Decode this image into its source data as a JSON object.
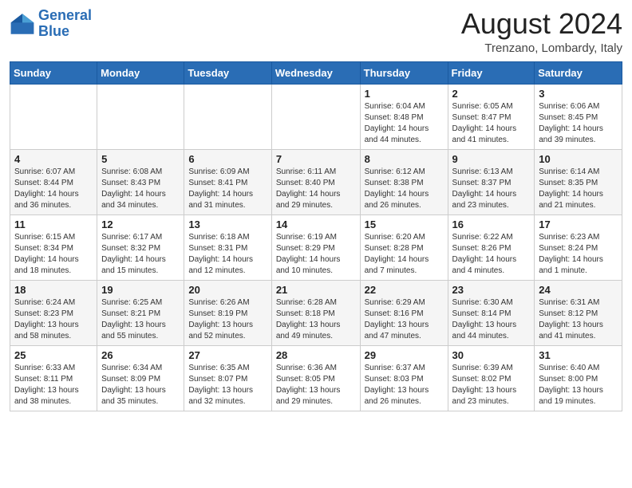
{
  "header": {
    "logo_line1": "General",
    "logo_line2": "Blue",
    "month_year": "August 2024",
    "location": "Trenzano, Lombardy, Italy"
  },
  "weekdays": [
    "Sunday",
    "Monday",
    "Tuesday",
    "Wednesday",
    "Thursday",
    "Friday",
    "Saturday"
  ],
  "weeks": [
    [
      {
        "day": "",
        "info": ""
      },
      {
        "day": "",
        "info": ""
      },
      {
        "day": "",
        "info": ""
      },
      {
        "day": "",
        "info": ""
      },
      {
        "day": "1",
        "info": "Sunrise: 6:04 AM\nSunset: 8:48 PM\nDaylight: 14 hours and 44 minutes."
      },
      {
        "day": "2",
        "info": "Sunrise: 6:05 AM\nSunset: 8:47 PM\nDaylight: 14 hours and 41 minutes."
      },
      {
        "day": "3",
        "info": "Sunrise: 6:06 AM\nSunset: 8:45 PM\nDaylight: 14 hours and 39 minutes."
      }
    ],
    [
      {
        "day": "4",
        "info": "Sunrise: 6:07 AM\nSunset: 8:44 PM\nDaylight: 14 hours and 36 minutes."
      },
      {
        "day": "5",
        "info": "Sunrise: 6:08 AM\nSunset: 8:43 PM\nDaylight: 14 hours and 34 minutes."
      },
      {
        "day": "6",
        "info": "Sunrise: 6:09 AM\nSunset: 8:41 PM\nDaylight: 14 hours and 31 minutes."
      },
      {
        "day": "7",
        "info": "Sunrise: 6:11 AM\nSunset: 8:40 PM\nDaylight: 14 hours and 29 minutes."
      },
      {
        "day": "8",
        "info": "Sunrise: 6:12 AM\nSunset: 8:38 PM\nDaylight: 14 hours and 26 minutes."
      },
      {
        "day": "9",
        "info": "Sunrise: 6:13 AM\nSunset: 8:37 PM\nDaylight: 14 hours and 23 minutes."
      },
      {
        "day": "10",
        "info": "Sunrise: 6:14 AM\nSunset: 8:35 PM\nDaylight: 14 hours and 21 minutes."
      }
    ],
    [
      {
        "day": "11",
        "info": "Sunrise: 6:15 AM\nSunset: 8:34 PM\nDaylight: 14 hours and 18 minutes."
      },
      {
        "day": "12",
        "info": "Sunrise: 6:17 AM\nSunset: 8:32 PM\nDaylight: 14 hours and 15 minutes."
      },
      {
        "day": "13",
        "info": "Sunrise: 6:18 AM\nSunset: 8:31 PM\nDaylight: 14 hours and 12 minutes."
      },
      {
        "day": "14",
        "info": "Sunrise: 6:19 AM\nSunset: 8:29 PM\nDaylight: 14 hours and 10 minutes."
      },
      {
        "day": "15",
        "info": "Sunrise: 6:20 AM\nSunset: 8:28 PM\nDaylight: 14 hours and 7 minutes."
      },
      {
        "day": "16",
        "info": "Sunrise: 6:22 AM\nSunset: 8:26 PM\nDaylight: 14 hours and 4 minutes."
      },
      {
        "day": "17",
        "info": "Sunrise: 6:23 AM\nSunset: 8:24 PM\nDaylight: 14 hours and 1 minute."
      }
    ],
    [
      {
        "day": "18",
        "info": "Sunrise: 6:24 AM\nSunset: 8:23 PM\nDaylight: 13 hours and 58 minutes."
      },
      {
        "day": "19",
        "info": "Sunrise: 6:25 AM\nSunset: 8:21 PM\nDaylight: 13 hours and 55 minutes."
      },
      {
        "day": "20",
        "info": "Sunrise: 6:26 AM\nSunset: 8:19 PM\nDaylight: 13 hours and 52 minutes."
      },
      {
        "day": "21",
        "info": "Sunrise: 6:28 AM\nSunset: 8:18 PM\nDaylight: 13 hours and 49 minutes."
      },
      {
        "day": "22",
        "info": "Sunrise: 6:29 AM\nSunset: 8:16 PM\nDaylight: 13 hours and 47 minutes."
      },
      {
        "day": "23",
        "info": "Sunrise: 6:30 AM\nSunset: 8:14 PM\nDaylight: 13 hours and 44 minutes."
      },
      {
        "day": "24",
        "info": "Sunrise: 6:31 AM\nSunset: 8:12 PM\nDaylight: 13 hours and 41 minutes."
      }
    ],
    [
      {
        "day": "25",
        "info": "Sunrise: 6:33 AM\nSunset: 8:11 PM\nDaylight: 13 hours and 38 minutes."
      },
      {
        "day": "26",
        "info": "Sunrise: 6:34 AM\nSunset: 8:09 PM\nDaylight: 13 hours and 35 minutes."
      },
      {
        "day": "27",
        "info": "Sunrise: 6:35 AM\nSunset: 8:07 PM\nDaylight: 13 hours and 32 minutes."
      },
      {
        "day": "28",
        "info": "Sunrise: 6:36 AM\nSunset: 8:05 PM\nDaylight: 13 hours and 29 minutes."
      },
      {
        "day": "29",
        "info": "Sunrise: 6:37 AM\nSunset: 8:03 PM\nDaylight: 13 hours and 26 minutes."
      },
      {
        "day": "30",
        "info": "Sunrise: 6:39 AM\nSunset: 8:02 PM\nDaylight: 13 hours and 23 minutes."
      },
      {
        "day": "31",
        "info": "Sunrise: 6:40 AM\nSunset: 8:00 PM\nDaylight: 13 hours and 19 minutes."
      }
    ]
  ]
}
